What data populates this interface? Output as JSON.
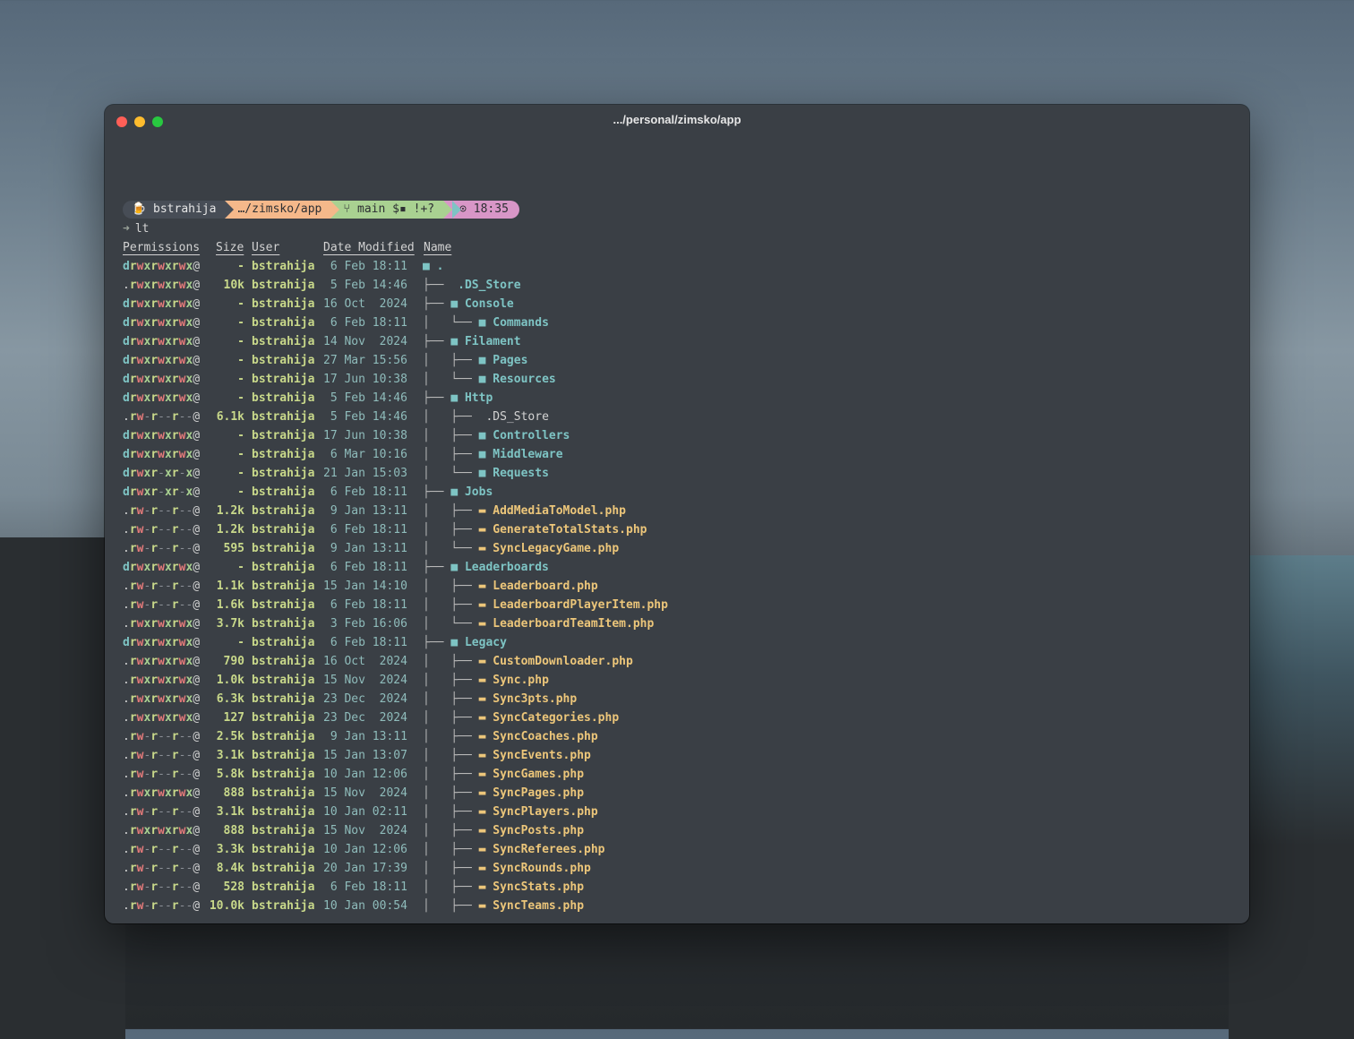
{
  "window": {
    "title": ".../personal/zimsko/app"
  },
  "prompt": {
    "user": "bstrahija",
    "user_icon": "🍺",
    "dir": "…/zimsko/app",
    "git_icon": "⑂",
    "git": "main $▪ !+?",
    "time_icon": "⊙",
    "time": "18:35",
    "symbol": "➜",
    "command": "lt"
  },
  "headers": {
    "permissions": "Permissions",
    "size": "Size",
    "user": "User",
    "date": "Date Modified",
    "name": "Name"
  },
  "colors": {
    "directory": "#7ec4c4",
    "file": "#ecc67a",
    "user": "#c8d88a",
    "date": "#8fbcbb"
  },
  "rows": [
    {
      "perm": "drwxrwxrwx@",
      "size": "-",
      "user": "bstrahija",
      "date": " 6 Feb 18:11",
      "tree": "",
      "icon": "folder",
      "name": "."
    },
    {
      "perm": ".rwxrwxrwx@",
      "size": "10k",
      "user": "bstrahija",
      "date": " 5 Feb 14:46",
      "tree": "├── ",
      "icon": "apple",
      "name": ".DS_Store",
      "style": "ds-b"
    },
    {
      "perm": "drwxrwxrwx@",
      "size": "-",
      "user": "bstrahija",
      "date": "16 Oct  2024",
      "tree": "├── ",
      "icon": "folder",
      "name": "Console"
    },
    {
      "perm": "drwxrwxrwx@",
      "size": "-",
      "user": "bstrahija",
      "date": " 6 Feb 18:11",
      "tree": "│   └── ",
      "icon": "folder",
      "name": "Commands"
    },
    {
      "perm": "drwxrwxrwx@",
      "size": "-",
      "user": "bstrahija",
      "date": "14 Nov  2024",
      "tree": "├── ",
      "icon": "folder",
      "name": "Filament"
    },
    {
      "perm": "drwxrwxrwx@",
      "size": "-",
      "user": "bstrahija",
      "date": "27 Mar 15:56",
      "tree": "│   ├── ",
      "icon": "folder",
      "name": "Pages"
    },
    {
      "perm": "drwxrwxrwx@",
      "size": "-",
      "user": "bstrahija",
      "date": "17 Jun 10:38",
      "tree": "│   └── ",
      "icon": "folder",
      "name": "Resources"
    },
    {
      "perm": "drwxrwxrwx@",
      "size": "-",
      "user": "bstrahija",
      "date": " 5 Feb 14:46",
      "tree": "├── ",
      "icon": "folder",
      "name": "Http"
    },
    {
      "perm": ".rw-r--r--@",
      "size": "6.1k",
      "user": "bstrahija",
      "date": " 5 Feb 14:46",
      "tree": "│   ├── ",
      "icon": "apple",
      "name": ".DS_Store",
      "style": "ds"
    },
    {
      "perm": "drwxrwxrwx@",
      "size": "-",
      "user": "bstrahija",
      "date": "17 Jun 10:38",
      "tree": "│   ├── ",
      "icon": "folder",
      "name": "Controllers"
    },
    {
      "perm": "drwxrwxrwx@",
      "size": "-",
      "user": "bstrahija",
      "date": " 6 Mar 10:16",
      "tree": "│   ├── ",
      "icon": "folder",
      "name": "Middleware"
    },
    {
      "perm": "drwxr-xr-x@",
      "size": "-",
      "user": "bstrahija",
      "date": "21 Jan 15:03",
      "tree": "│   └── ",
      "icon": "folder",
      "name": "Requests"
    },
    {
      "perm": "drwxr-xr-x@",
      "size": "-",
      "user": "bstrahija",
      "date": " 6 Feb 18:11",
      "tree": "├── ",
      "icon": "folder",
      "name": "Jobs"
    },
    {
      "perm": ".rw-r--r--@",
      "size": "1.2k",
      "user": "bstrahija",
      "date": " 9 Jan 13:11",
      "tree": "│   ├── ",
      "icon": "file",
      "name": "AddMediaToModel.php"
    },
    {
      "perm": ".rw-r--r--@",
      "size": "1.2k",
      "user": "bstrahija",
      "date": " 6 Feb 18:11",
      "tree": "│   ├── ",
      "icon": "file",
      "name": "GenerateTotalStats.php"
    },
    {
      "perm": ".rw-r--r--@",
      "size": "595",
      "user": "bstrahija",
      "date": " 9 Jan 13:11",
      "tree": "│   └── ",
      "icon": "file",
      "name": "SyncLegacyGame.php"
    },
    {
      "perm": "drwxrwxrwx@",
      "size": "-",
      "user": "bstrahija",
      "date": " 6 Feb 18:11",
      "tree": "├── ",
      "icon": "folder",
      "name": "Leaderboards"
    },
    {
      "perm": ".rw-r--r--@",
      "size": "1.1k",
      "user": "bstrahija",
      "date": "15 Jan 14:10",
      "tree": "│   ├── ",
      "icon": "file",
      "name": "Leaderboard.php"
    },
    {
      "perm": ".rw-r--r--@",
      "size": "1.6k",
      "user": "bstrahija",
      "date": " 6 Feb 18:11",
      "tree": "│   ├── ",
      "icon": "file",
      "name": "LeaderboardPlayerItem.php"
    },
    {
      "perm": ".rwxrwxrwx@",
      "size": "3.7k",
      "user": "bstrahija",
      "date": " 3 Feb 16:06",
      "tree": "│   └── ",
      "icon": "file",
      "name": "LeaderboardTeamItem.php"
    },
    {
      "perm": "drwxrwxrwx@",
      "size": "-",
      "user": "bstrahija",
      "date": " 6 Feb 18:11",
      "tree": "├── ",
      "icon": "folder",
      "name": "Legacy"
    },
    {
      "perm": ".rwxrwxrwx@",
      "size": "790",
      "user": "bstrahija",
      "date": "16 Oct  2024",
      "tree": "│   ├── ",
      "icon": "file",
      "name": "CustomDownloader.php"
    },
    {
      "perm": ".rwxrwxrwx@",
      "size": "1.0k",
      "user": "bstrahija",
      "date": "15 Nov  2024",
      "tree": "│   ├── ",
      "icon": "file",
      "name": "Sync.php"
    },
    {
      "perm": ".rwxrwxrwx@",
      "size": "6.3k",
      "user": "bstrahija",
      "date": "23 Dec  2024",
      "tree": "│   ├── ",
      "icon": "file",
      "name": "Sync3pts.php"
    },
    {
      "perm": ".rwxrwxrwx@",
      "size": "127",
      "user": "bstrahija",
      "date": "23 Dec  2024",
      "tree": "│   ├── ",
      "icon": "file",
      "name": "SyncCategories.php"
    },
    {
      "perm": ".rw-r--r--@",
      "size": "2.5k",
      "user": "bstrahija",
      "date": " 9 Jan 13:11",
      "tree": "│   ├── ",
      "icon": "file",
      "name": "SyncCoaches.php"
    },
    {
      "perm": ".rw-r--r--@",
      "size": "3.1k",
      "user": "bstrahija",
      "date": "15 Jan 13:07",
      "tree": "│   ├── ",
      "icon": "file",
      "name": "SyncEvents.php"
    },
    {
      "perm": ".rw-r--r--@",
      "size": "5.8k",
      "user": "bstrahija",
      "date": "10 Jan 12:06",
      "tree": "│   ├── ",
      "icon": "file",
      "name": "SyncGames.php"
    },
    {
      "perm": ".rwxrwxrwx@",
      "size": "888",
      "user": "bstrahija",
      "date": "15 Nov  2024",
      "tree": "│   ├── ",
      "icon": "file",
      "name": "SyncPages.php"
    },
    {
      "perm": ".rw-r--r--@",
      "size": "3.1k",
      "user": "bstrahija",
      "date": "10 Jan 02:11",
      "tree": "│   ├── ",
      "icon": "file",
      "name": "SyncPlayers.php"
    },
    {
      "perm": ".rwxrwxrwx@",
      "size": "888",
      "user": "bstrahija",
      "date": "15 Nov  2024",
      "tree": "│   ├── ",
      "icon": "file",
      "name": "SyncPosts.php"
    },
    {
      "perm": ".rw-r--r--@",
      "size": "3.3k",
      "user": "bstrahija",
      "date": "10 Jan 12:06",
      "tree": "│   ├── ",
      "icon": "file",
      "name": "SyncReferees.php"
    },
    {
      "perm": ".rw-r--r--@",
      "size": "8.4k",
      "user": "bstrahija",
      "date": "20 Jan 17:39",
      "tree": "│   ├── ",
      "icon": "file",
      "name": "SyncRounds.php"
    },
    {
      "perm": ".rw-r--r--@",
      "size": "528",
      "user": "bstrahija",
      "date": " 6 Feb 18:11",
      "tree": "│   ├── ",
      "icon": "file",
      "name": "SyncStats.php"
    },
    {
      "perm": ".rw-r--r--@",
      "size": "10.0k",
      "user": "bstrahija",
      "date": "10 Jan 00:54",
      "tree": "│   ├── ",
      "icon": "file",
      "name": "SyncTeams.php"
    }
  ]
}
